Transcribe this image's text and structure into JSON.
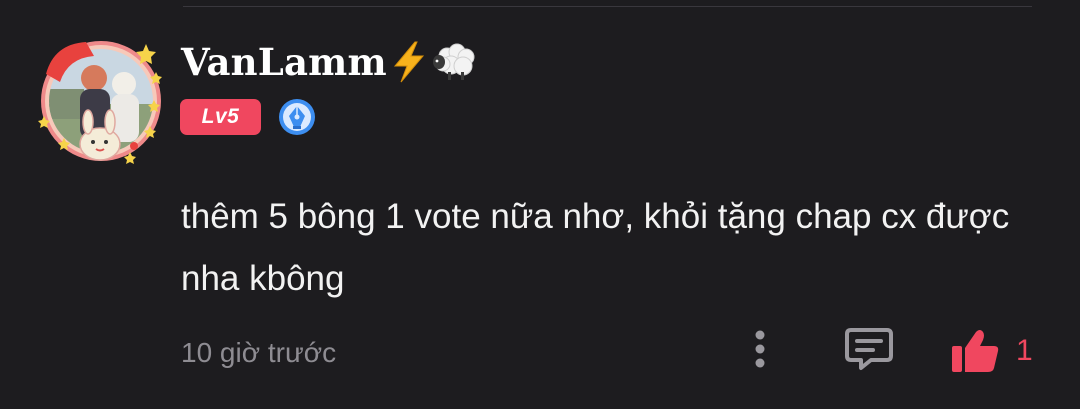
{
  "comment": {
    "username": "VanLamm",
    "username_icons": [
      "lightning-icon",
      "sheep-icon"
    ],
    "level_badge": "Lv5",
    "level_badge_color": "#f0475f",
    "extra_badge_icon": "pen-nib-icon",
    "text": "thêm 5 bông 1 vote nữa nhơ, khỏi tặng chap cx được nha kbông",
    "timestamp": "10 giờ trước",
    "like_count": "1",
    "like_color": "#f0475f",
    "actions": {
      "more_icon": "more-vertical-icon",
      "reply_icon": "comment-icon",
      "like_icon": "thumbs-up-icon"
    }
  }
}
